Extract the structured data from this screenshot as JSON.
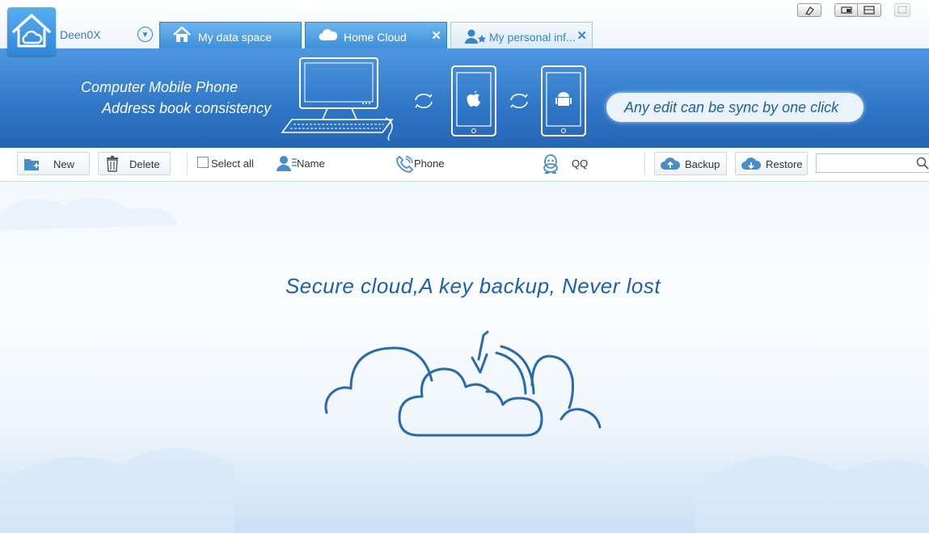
{
  "app": {
    "user": "Deen0X"
  },
  "tabs": [
    {
      "label": "My data space",
      "icon": "home-icon",
      "closable": false,
      "active": false
    },
    {
      "label": "Home Cloud",
      "icon": "cloud-icon",
      "closable": true,
      "active": false
    },
    {
      "label": "My personal inf...",
      "icon": "contact-star-icon",
      "closable": true,
      "active": true
    }
  ],
  "tab_close_glyph": "✕",
  "banner": {
    "line1": "Computer Mobile Phone",
    "line2": "Address book consistency",
    "sync_message": "Any edit can be sync by one click"
  },
  "toolbar": {
    "new_label": "New",
    "delete_label": "Delete",
    "select_all_label": "Select all",
    "name_label": "Name",
    "phone_label": "Phone",
    "qq_label": "QQ",
    "backup_label": "Backup",
    "restore_label": "Restore",
    "search_value": ""
  },
  "main": {
    "tagline": "Secure cloud,A key backup, Never lost"
  },
  "colors": {
    "accent": "#2f7fc8",
    "banner_top": "#4f97e0",
    "banner_bottom": "#2566b4",
    "tagline": "#1f5fa6"
  }
}
